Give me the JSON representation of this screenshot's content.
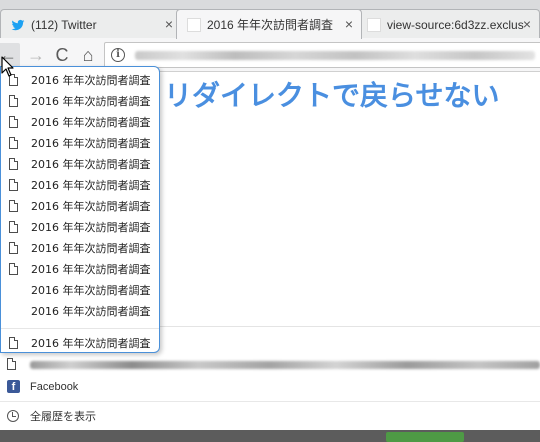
{
  "tabs": [
    {
      "title": "(112) Twitter",
      "close": "×",
      "favicon": "twitter-bird-icon",
      "active": false
    },
    {
      "title": "2016 年年次訪問者調査",
      "close": "×",
      "favicon": "blank-page-icon",
      "active": true
    },
    {
      "title": "view-source:6d3zz.exclus",
      "close": "×",
      "favicon": "blank-page-icon",
      "active": false
    }
  ],
  "toolbar": {
    "back": "←",
    "forward": "→",
    "reload": "C",
    "home": "⌂",
    "info": "i"
  },
  "page": {
    "heading": "リダイレクトで戻らせない"
  },
  "back_history": {
    "items": [
      {
        "label": "2016 年年次訪問者調査",
        "icon": "blank-page-icon"
      },
      {
        "label": "2016 年年次訪問者調査",
        "icon": "blank-page-icon"
      },
      {
        "label": "2016 年年次訪問者調査",
        "icon": "blank-page-icon"
      },
      {
        "label": "2016 年年次訪問者調査",
        "icon": "blank-page-icon"
      },
      {
        "label": "2016 年年次訪問者調査",
        "icon": "blank-page-icon"
      },
      {
        "label": "2016 年年次訪問者調査",
        "icon": "blank-page-icon"
      },
      {
        "label": "2016 年年次訪問者調査",
        "icon": "blank-page-icon"
      },
      {
        "label": "2016 年年次訪問者調査",
        "icon": "blank-page-icon"
      },
      {
        "label": "2016 年年次訪問者調査",
        "icon": "blank-page-icon"
      },
      {
        "label": "2016 年年次訪問者調査",
        "icon": "blank-page-icon"
      },
      {
        "label": "2016 年年次訪問者調査",
        "icon": "none"
      },
      {
        "label": "2016 年年次訪問者調査",
        "icon": "none"
      }
    ],
    "last_item": {
      "label": "2016 年年次訪問者調査",
      "icon": "blank-page-icon"
    }
  },
  "below_menu": {
    "facebook_label": "Facebook",
    "show_history_label": "全履歴を表示"
  },
  "colors": {
    "heading": "#4a8fe0",
    "dropdown_border": "#4a90d9",
    "facebook": "#3b5998",
    "twitter": "#1da1f2"
  }
}
